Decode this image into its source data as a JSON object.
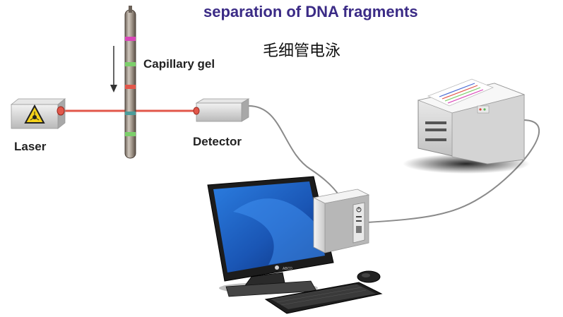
{
  "title": "separation of DNA fragments",
  "subtitle": "毛细管电泳",
  "labels": {
    "capillary": "Capillary gel",
    "laser": "Laser",
    "detector": "Detector"
  },
  "colors": {
    "title": "#3b2b86",
    "laser_beam": "#e2574a",
    "band_magenta": "#d946b8",
    "band_green": "#7ccf6a",
    "band_red": "#e2574a",
    "band_teal": "#4a9c9a",
    "screen_blue": "#1f5fc0"
  },
  "icons": [
    "laser-warning-icon",
    "down-arrow-icon",
    "power-icon"
  ]
}
